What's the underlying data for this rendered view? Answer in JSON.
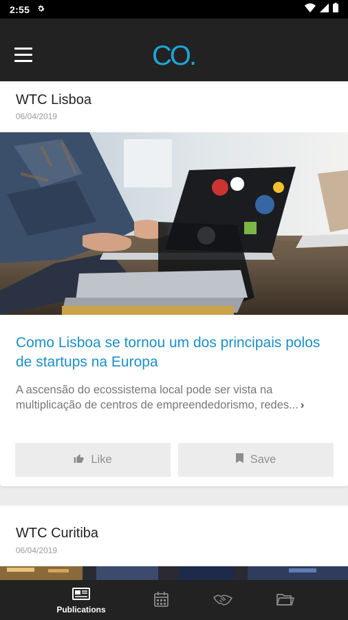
{
  "status_bar": {
    "time": "2:55"
  },
  "app": {
    "logo_text": "CO."
  },
  "feed": {
    "posts": [
      {
        "location": "WTC Lisboa",
        "date": "06/04/2019",
        "headline": "Como Lisboa se tornou um dos principais polos de startups na Europa",
        "excerpt": "A ascensão do ecossistema local pode ser vista na multiplicação de centros de empreendedorismo, redes...",
        "like_label": "Like",
        "save_label": "Save"
      },
      {
        "location": "WTC Curitiba",
        "date": "06/04/2019"
      }
    ]
  },
  "bottom_nav": {
    "items": [
      {
        "label": "Publications",
        "icon": "newspaper-icon",
        "active": true
      },
      {
        "label": "",
        "icon": "calendar-icon",
        "active": false
      },
      {
        "label": "",
        "icon": "handshake-icon",
        "active": false
      },
      {
        "label": "",
        "icon": "folder-icon",
        "active": false
      }
    ]
  },
  "colors": {
    "accent": "#1a8fc6",
    "app_bar": "#222222",
    "logo": "#1da4d8",
    "background": "#ececec"
  }
}
